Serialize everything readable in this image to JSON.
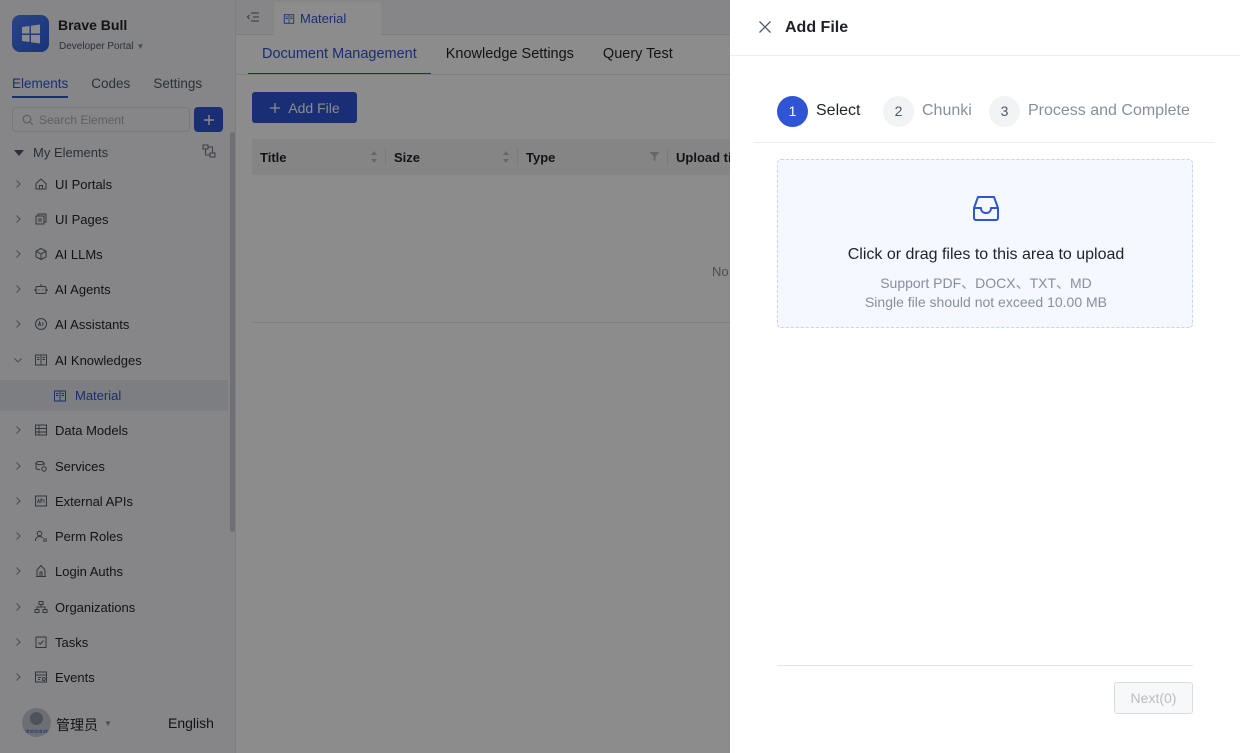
{
  "brand": {
    "name": "Brave Bull",
    "portal": "Developer Portal"
  },
  "sidebar": {
    "tabs": [
      {
        "label": "Elements"
      },
      {
        "label": "Codes"
      },
      {
        "label": "Settings"
      }
    ],
    "search": {
      "placeholder": "Search Element"
    },
    "tree_header": "My Elements",
    "items": [
      {
        "label": "UI Portals",
        "icon": "home-icon"
      },
      {
        "label": "UI Pages",
        "icon": "pages-icon"
      },
      {
        "label": "AI LLMs",
        "icon": "llm-cube-icon"
      },
      {
        "label": "AI Agents",
        "icon": "robot-icon"
      },
      {
        "label": "AI Assistants",
        "icon": "ai-badge-icon"
      },
      {
        "label": "AI Knowledges",
        "icon": "book-icon"
      },
      {
        "label": "Material",
        "icon": "book-icon"
      },
      {
        "label": "Data Models",
        "icon": "table-icon"
      },
      {
        "label": "Services",
        "icon": "services-icon"
      },
      {
        "label": "External APIs",
        "icon": "api-icon"
      },
      {
        "label": "Perm Roles",
        "icon": "roles-icon"
      },
      {
        "label": "Login Auths",
        "icon": "login-icon"
      },
      {
        "label": "Organizations",
        "icon": "org-icon"
      },
      {
        "label": "Tasks",
        "icon": "task-icon"
      },
      {
        "label": "Events",
        "icon": "event-icon"
      }
    ],
    "user": {
      "name": "管理员",
      "role_tag": "Administrator"
    },
    "language": "English"
  },
  "main": {
    "page_tab": "Material",
    "subtabs": [
      {
        "label": "Document Management"
      },
      {
        "label": "Knowledge Settings"
      },
      {
        "label": "Query Test"
      }
    ],
    "add_file_label": "Add File",
    "columns": [
      {
        "label": "Title"
      },
      {
        "label": "Size"
      },
      {
        "label": "Type"
      },
      {
        "label": "Upload ti"
      }
    ],
    "empty_text": "No"
  },
  "drawer": {
    "title": "Add File",
    "steps": [
      {
        "num": "1",
        "label": "Select",
        "status": "active"
      },
      {
        "num": "2",
        "label": "Chunki",
        "status": "pending"
      },
      {
        "num": "3",
        "label": "Process and Complete",
        "status": "pending"
      }
    ],
    "upload": {
      "main_text": "Click or drag files to this area to upload",
      "support_text": "Support PDF、DOCX、TXT、MD",
      "limit_text": "Single file should not exceed 10.00 MB"
    },
    "next_label": "Next(0)"
  },
  "colors": {
    "primary": "#2f55d4",
    "overlay": "rgba(0,0,0,0.45)",
    "upload_bg": "#f5f8fe"
  }
}
